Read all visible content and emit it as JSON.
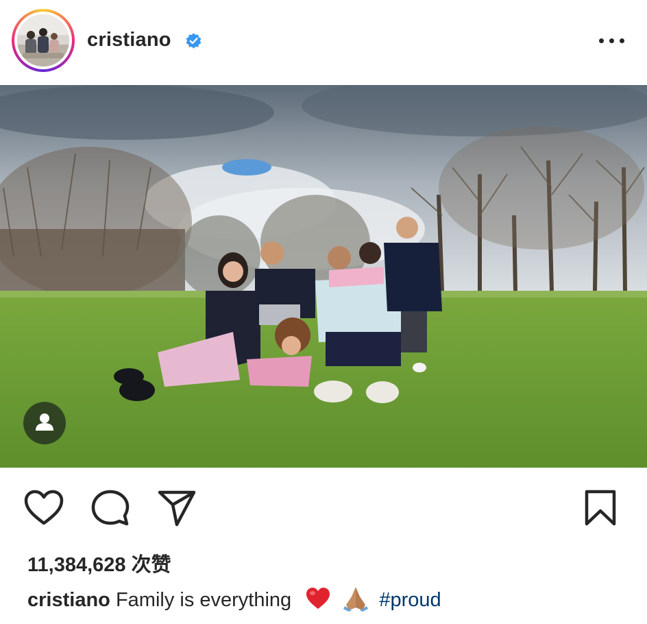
{
  "post": {
    "username": "cristiano",
    "verified": true,
    "more_icon": "more-horizontal-icon",
    "tag_icon": "user-tag-icon",
    "likes_count": "11,384,628",
    "likes_suffix": "次赞",
    "caption": {
      "username": "cristiano",
      "text": "Family is everything",
      "emojis": [
        "red-heart",
        "folded-hands"
      ],
      "hashtag": "#proud"
    }
  },
  "actions": {
    "like_icon": "heart-icon",
    "comment_icon": "comment-icon",
    "share_icon": "send-icon",
    "save_icon": "bookmark-icon"
  },
  "colors": {
    "text": "#262626",
    "verified_blue": "#3897f0",
    "hashtag": "#00376b",
    "heart_red": "#e0242f"
  }
}
